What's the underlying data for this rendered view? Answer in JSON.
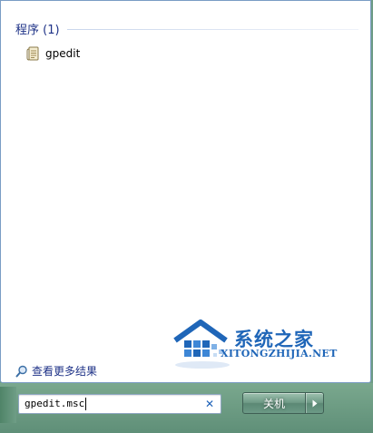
{
  "results": {
    "section_title": "程序 (1)",
    "items": [
      {
        "label": "gpedit",
        "icon": "gpedit-icon"
      }
    ]
  },
  "see_more": {
    "label": "查看更多结果",
    "icon": "search-icon"
  },
  "search": {
    "value": "gpedit.msc",
    "clear_icon": "close-icon"
  },
  "shutdown": {
    "label": "关机",
    "arrow_icon": "chevron-right-icon"
  },
  "watermark": {
    "brand": "系统之家",
    "url": "XITONGZHIJIA.NET"
  },
  "colors": {
    "accent_text": "#1e3287",
    "taskbar": "#6f9d86",
    "watermark": "#1f66b8"
  }
}
